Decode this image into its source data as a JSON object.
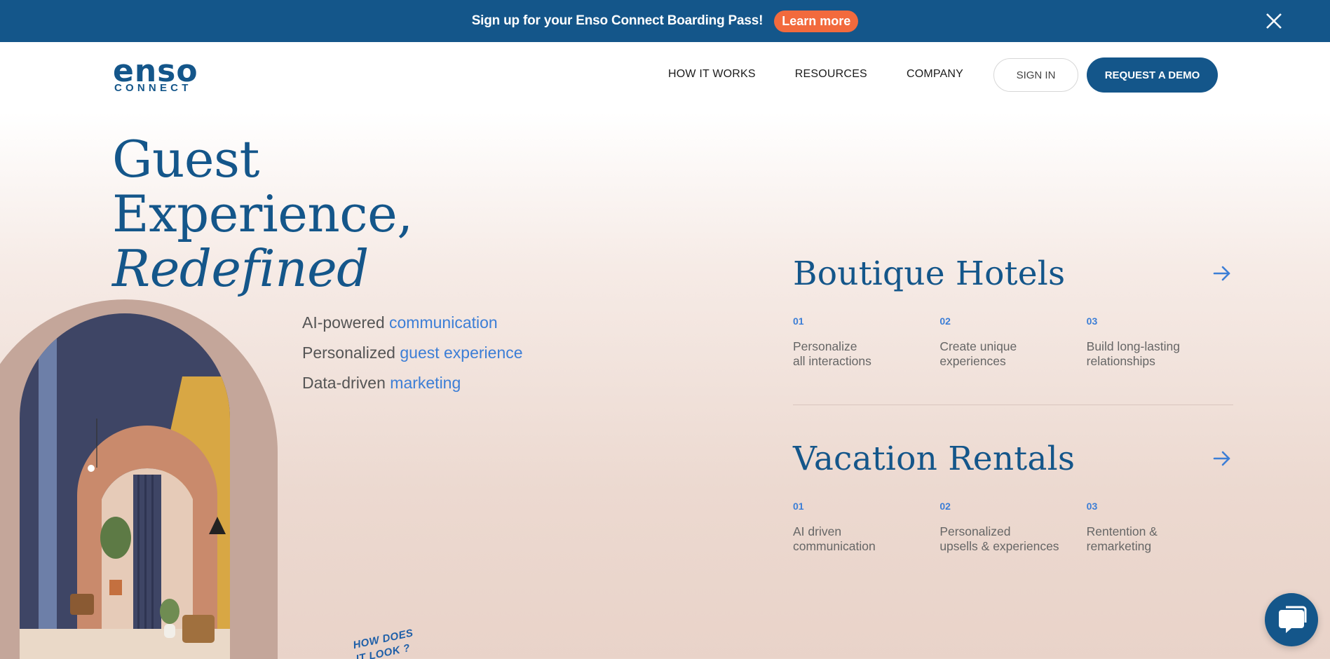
{
  "announcement": {
    "text": "Sign up for your Enso Connect Boarding Pass!",
    "button": "Learn more"
  },
  "logo": {
    "main": "enso",
    "sub": "CONNECT"
  },
  "nav": {
    "items": [
      "HOW IT WORKS",
      "RESOURCES",
      "COMPANY"
    ],
    "sign_in": "SIGN IN",
    "demo": "REQUEST A DEMO"
  },
  "hero": {
    "line1": "Guest",
    "line2": "Experience,",
    "line3": "Redefined"
  },
  "features": [
    {
      "prefix": "AI-powered",
      "highlight": "communication"
    },
    {
      "prefix": "Personalized",
      "highlight": "guest experience"
    },
    {
      "prefix": "Data-driven",
      "highlight": "marketing"
    }
  ],
  "how_note": {
    "line1": "HOW DOES",
    "line2": "IT LOOK ?"
  },
  "segments": [
    {
      "title": "Boutique Hotels",
      "items": [
        {
          "num": "01",
          "text": "Personalize\nall interactions"
        },
        {
          "num": "02",
          "text": "Create unique\nexperiences"
        },
        {
          "num": "03",
          "text": "Build long-lasting\nrelationships"
        }
      ]
    },
    {
      "title": "Vacation Rentals",
      "items": [
        {
          "num": "01",
          "text": "AI driven\ncommunication"
        },
        {
          "num": "02",
          "text": "Personalized\nupsells & experiences"
        },
        {
          "num": "03",
          "text": "Rentention &\nremarketing"
        }
      ]
    }
  ],
  "colors": {
    "brand_blue": "#14568a",
    "accent_blue": "#3c7ed6",
    "accent_orange": "#f26a3d"
  },
  "icons": {
    "close": "close-icon",
    "arrow": "arrow-right-icon",
    "chat": "chat-bubble-icon"
  }
}
